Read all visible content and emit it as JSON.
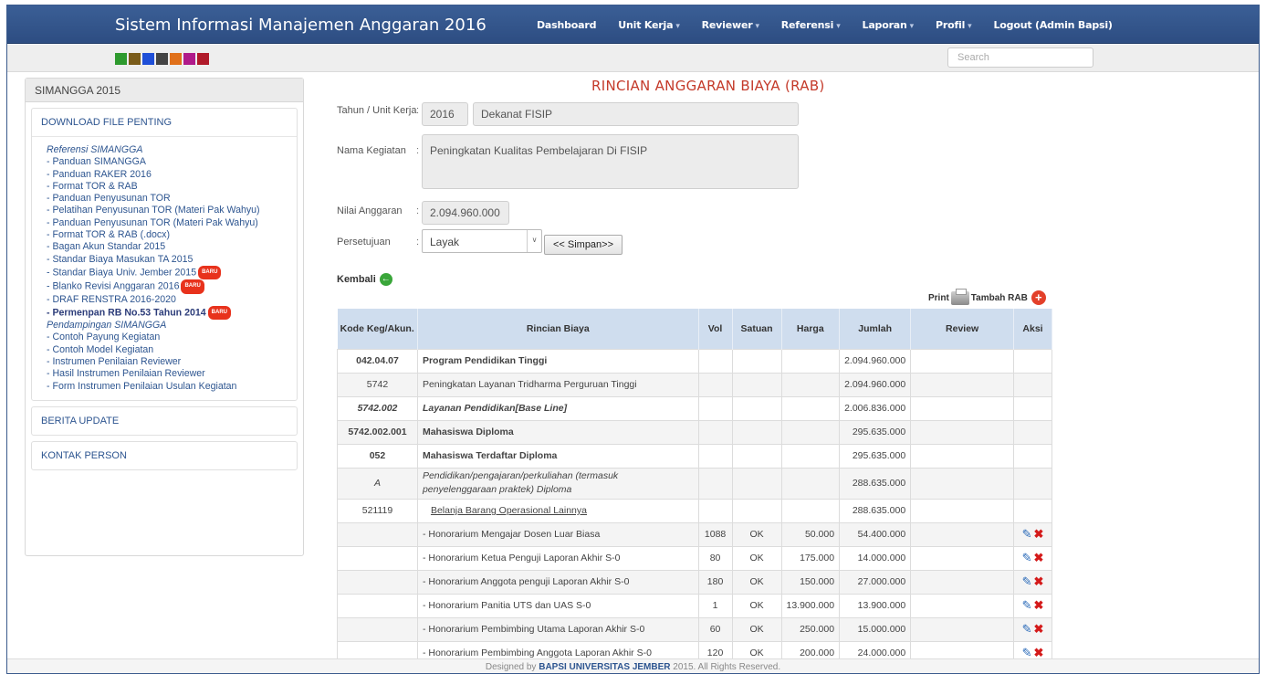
{
  "navbar": {
    "brand": "Sistem Informasi Manajemen Anggaran 2016",
    "items": [
      {
        "label": "Dashboard",
        "caret": ""
      },
      {
        "label": "Unit Kerja",
        "caret": "▾"
      },
      {
        "label": "Reviewer",
        "caret": "▾"
      },
      {
        "label": "Referensi",
        "caret": "▾"
      },
      {
        "label": "Laporan",
        "caret": "▾"
      },
      {
        "label": "Profil",
        "caret": "▾"
      },
      {
        "label": "Logout (Admin Bapsi)",
        "caret": ""
      }
    ]
  },
  "swatches": [
    "#2e9a2e",
    "#7a5c1a",
    "#1f4fd8",
    "#444444",
    "#e0701a",
    "#b01a8a",
    "#b01a2a"
  ],
  "search": {
    "placeholder": "Search"
  },
  "sidebar": {
    "header": "SIMANGGA 2015",
    "download_title": "DOWNLOAD FILE PENTING",
    "group1": "Referensi SIMANGGA",
    "links1": [
      "- Panduan SIMANGGA",
      "- Panduan RAKER 2016",
      "- Format TOR & RAB",
      "- Panduan Penyusunan TOR",
      "- Pelatihan Penyusunan TOR (Materi Pak Wahyu)",
      "- Panduan Penyusunan TOR (Materi Pak Wahyu)",
      "- Format TOR & RAB (.docx)",
      "- Bagan Akun Standar 2015",
      "- Standar Biaya Masukan TA 2015"
    ],
    "link_standar_univ": "- Standar Biaya Univ. Jember 2015",
    "link_blanko": "- Blanko Revisi Anggaran 2016",
    "link_renstra": "- DRAF RENSTRA 2016-2020",
    "link_permenpan": "- Permenpan RB No.53 Tahun 2014",
    "badge": "BARU",
    "group2": "Pendampingan SIMANGGA",
    "links2": [
      "- Contoh Payung Kegiatan",
      "- Contoh Model Kegiatan",
      "- Instrumen Penilaian Reviewer",
      "- Hasil Instrumen Penilaian Reviewer",
      "- Form Instrumen Penilaian Usulan Kegiatan"
    ],
    "berita": "BERITA UPDATE",
    "kontak": "KONTAK PERSON"
  },
  "form": {
    "title": "RINCIAN ANGGARAN BIAYA (RAB)",
    "tahun_label": "Tahun / Unit Kerja",
    "tahun_value": "2016",
    "unit_value": "Dekanat FISIP",
    "kegiatan_label": "Nama Kegiatan",
    "kegiatan_value": "Peningkatan Kualitas Pembelajaran Di FISIP",
    "nilai_label": "Nilai Anggaran",
    "nilai_value": "2.094.960.000",
    "persetujuan_label": "Persetujuan",
    "persetujuan_value": "Layak",
    "simpan_label": "<< Simpan>>",
    "kembali_label": "Kembali",
    "print_label": "Print",
    "tambah_label": "Tambah RAB"
  },
  "table": {
    "headers": [
      "Kode Keg/Akun.",
      "Rincian Biaya",
      "Vol",
      "Satuan",
      "Harga",
      "Jumlah",
      "Review",
      "Aksi"
    ],
    "rows": [
      {
        "kode": "042.04.07",
        "rincian": "Program Pendidikan Tinggi",
        "vol": "",
        "satuan": "",
        "harga": "",
        "jumlah": "2.094.960.000"
      },
      {
        "kode": "5742",
        "rincian": "Peningkatan Layanan Tridharma Perguruan Tinggi",
        "vol": "",
        "satuan": "",
        "harga": "",
        "jumlah": "2.094.960.000"
      },
      {
        "kode": "5742.002",
        "rincian": "Layanan Pendidikan[Base Line]",
        "vol": "",
        "satuan": "",
        "harga": "",
        "jumlah": "2.006.836.000"
      },
      {
        "kode": "5742.002.001",
        "rincian": "Mahasiswa Diploma",
        "vol": "",
        "satuan": "",
        "harga": "",
        "jumlah": "295.635.000"
      },
      {
        "kode": "052",
        "rincian": "Mahasiswa Terdaftar Diploma",
        "vol": "",
        "satuan": "",
        "harga": "",
        "jumlah": "295.635.000"
      },
      {
        "kode": "A",
        "rincian_line1": "Pendidikan/pengajaran/perkuliahan (termasuk",
        "rincian_line2": "penyelenggaraan praktek) Diploma",
        "vol": "",
        "satuan": "",
        "harga": "",
        "jumlah": "288.635.000"
      },
      {
        "kode": "521119",
        "rincian": "Belanja Barang Operasional Lainnya",
        "vol": "",
        "satuan": "",
        "harga": "",
        "jumlah": "288.635.000"
      },
      {
        "kode": "",
        "rincian": "- Honorarium Mengajar Dosen Luar Biasa",
        "vol": "1088",
        "satuan": "OK",
        "harga": "50.000",
        "jumlah": "54.400.000"
      },
      {
        "kode": "",
        "rincian": "- Honorarium Ketua Penguji Laporan Akhir S-0",
        "vol": "80",
        "satuan": "OK",
        "harga": "175.000",
        "jumlah": "14.000.000"
      },
      {
        "kode": "",
        "rincian": "- Honorarium Anggota penguji Laporan Akhir S-0",
        "vol": "180",
        "satuan": "OK",
        "harga": "150.000",
        "jumlah": "27.000.000"
      },
      {
        "kode": "",
        "rincian": "- Honorarium Panitia UTS dan UAS S-0",
        "vol": "1",
        "satuan": "OK",
        "harga": "13.900.000",
        "jumlah": "13.900.000"
      },
      {
        "kode": "",
        "rincian": "- Honorarium Pembimbing Utama Laporan Akhir S-0",
        "vol": "60",
        "satuan": "OK",
        "harga": "250.000",
        "jumlah": "15.000.000"
      },
      {
        "kode": "",
        "rincian": "- Honorarium Pembimbing Anggota Laporan Akhir S-0",
        "vol": "120",
        "satuan": "OK",
        "harga": "200.000",
        "jumlah": "24.000.000"
      }
    ]
  },
  "footer": {
    "prefix": "Designed by",
    "org": "BAPSI UNIVERSITAS JEMBER",
    "suffix": "2015. All Rights Reserved."
  }
}
